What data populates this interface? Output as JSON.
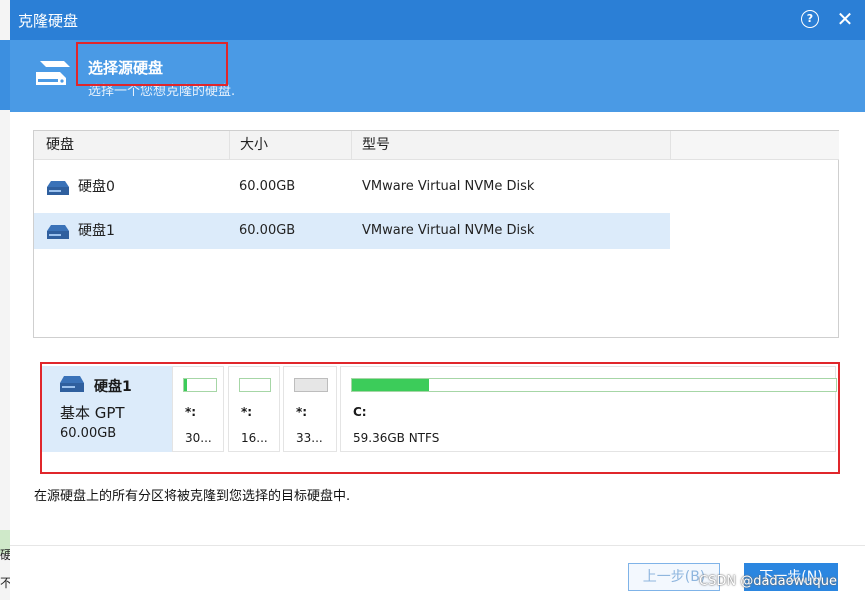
{
  "window": {
    "title": "克隆硬盘",
    "help_glyph": "?",
    "close_glyph": "✕"
  },
  "header": {
    "title": "选择源硬盘",
    "subtitle": "选择一个您想克隆的硬盘."
  },
  "table": {
    "columns": [
      "硬盘",
      "大小",
      "型号"
    ],
    "rows": [
      {
        "name": "硬盘0",
        "size": "60.00GB",
        "model": "VMware Virtual NVMe Disk",
        "selected": false
      },
      {
        "name": "硬盘1",
        "size": "60.00GB",
        "model": "VMware Virtual NVMe Disk",
        "selected": true
      }
    ]
  },
  "source_disk": {
    "name": "硬盘1",
    "type": "基本 GPT",
    "capacity": "60.00GB",
    "partitions": [
      {
        "label": "*:",
        "info": "30...",
        "fill_fraction": 0.1,
        "fill_color": "#3ccc5a"
      },
      {
        "label": "*:",
        "info": "16...",
        "fill_fraction": 0.0,
        "fill_color": "#3ccc5a"
      },
      {
        "label": "*:",
        "info": "33...",
        "fill_fraction": 1.0,
        "fill_color": "#e6e6e6"
      },
      {
        "label": "C:",
        "info": "59.36GB NTFS",
        "fill_fraction": 0.16,
        "fill_color": "#3ccc5a"
      }
    ]
  },
  "note": "在源硬盘上的所有分区将被克隆到您选择的目标硬盘中.",
  "buttons": {
    "prev": "上一步(B)",
    "next": "下一步(N)"
  },
  "watermark": "CSDN @dadaowuque",
  "background_window": {
    "chars": [
      "硬",
      "不"
    ]
  },
  "colors": {
    "titlebar": "#2b7fd6",
    "header": "#4a9ae5",
    "selection": "#dcebfa",
    "annotation": "#e0262b",
    "used_space": "#3ccc5a"
  }
}
